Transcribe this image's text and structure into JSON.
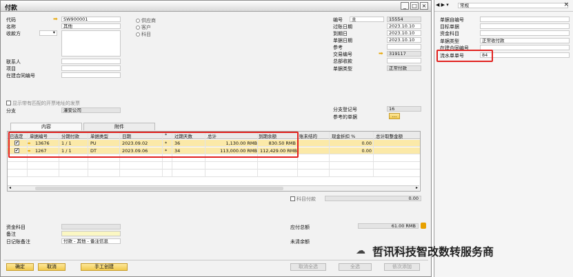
{
  "window": {
    "title": "付款"
  },
  "left": {
    "code_label": "代码",
    "code_value": "SW900001",
    "name_label": "名称",
    "name_value": "其他",
    "payee_label": "收款方",
    "contact_label": "联系人",
    "project_label": "项目",
    "contract_label": "在建合同编号",
    "radio_supplier": "供应商",
    "radio_customer": "客户",
    "radio_account": "科目",
    "show_invoice_label": "显示带有匹配的开票地址的发票",
    "branch_label": "分支",
    "branch_value": "灌安公司"
  },
  "right": {
    "docno_label": "编号",
    "docno_series": "主",
    "docno_value": "15554",
    "posting_label": "过账日期",
    "posting_value": "2023.10.10",
    "due_label": "到期日",
    "due_value": "2023.10.10",
    "docdate_label": "单据日期",
    "docdate_value": "2023.10.10",
    "ref_label": "参考",
    "trans_label": "交易编号",
    "trans_value": "319117",
    "gl_label": "总部收款",
    "doctype_label": "单据类型",
    "doctype_value": "正常付款",
    "branch_reg_label": "分支登记号",
    "branch_reg_value": "16",
    "ref_docs_label": "参考的单据",
    "ref_docs_btn": "..."
  },
  "tabs": [
    "内容",
    "附件"
  ],
  "grid": {
    "headers": [
      "已选定",
      "单据编号",
      "分期付款",
      "单据类型",
      "日期",
      "*",
      "过期天数",
      "总计",
      "到期余额",
      "账未结的",
      "现金折扣 %",
      "总计取整金额"
    ],
    "rows": [
      {
        "doc": "13676",
        "inst": "1 / 1",
        "type": "PU",
        "date": "2023.09.02",
        "star": "*",
        "days": "36",
        "total": "1,130.00 RMB",
        "balance": "830.50 RMB",
        "disc": "0.00"
      },
      {
        "doc": "1267",
        "inst": "1 / 1",
        "type": "DT",
        "date": "2023.09.06",
        "star": "*",
        "days": "34",
        "total": "113,000.00 RMB",
        "balance": "112,429.00 RMB",
        "disc": "0.00"
      }
    ]
  },
  "acct_pay_label": "科目付款",
  "acct_pay_value": "0.00",
  "bottom": {
    "fund_label": "资金科目",
    "memo_label": "备注",
    "journal_label": "日记账备注",
    "journal_value": "付款 - 其他 - 备注信息",
    "due_total_label": "应付总额",
    "due_total_value": "61.00 RMB",
    "open_label": "未清余额",
    "open_value": "31"
  },
  "buttons": {
    "ok": "确定",
    "cancel": "取消",
    "manual": "手工创建",
    "deselect_all": "取消全选",
    "select_all": "全选",
    "add_in_order": "依次添加"
  },
  "side": {
    "nav_value": "常规",
    "fields": [
      {
        "label": "单据自编号",
        "value": ""
      },
      {
        "label": "目标单据",
        "value": ""
      },
      {
        "label": "资金科目",
        "value": ""
      },
      {
        "label": "单据类型",
        "value": "正常收付款"
      },
      {
        "label": "在建合同编号",
        "value": ""
      },
      {
        "label": "流水单单号",
        "value": "84"
      }
    ]
  },
  "watermark": "哲讯科技智改数转服务商"
}
